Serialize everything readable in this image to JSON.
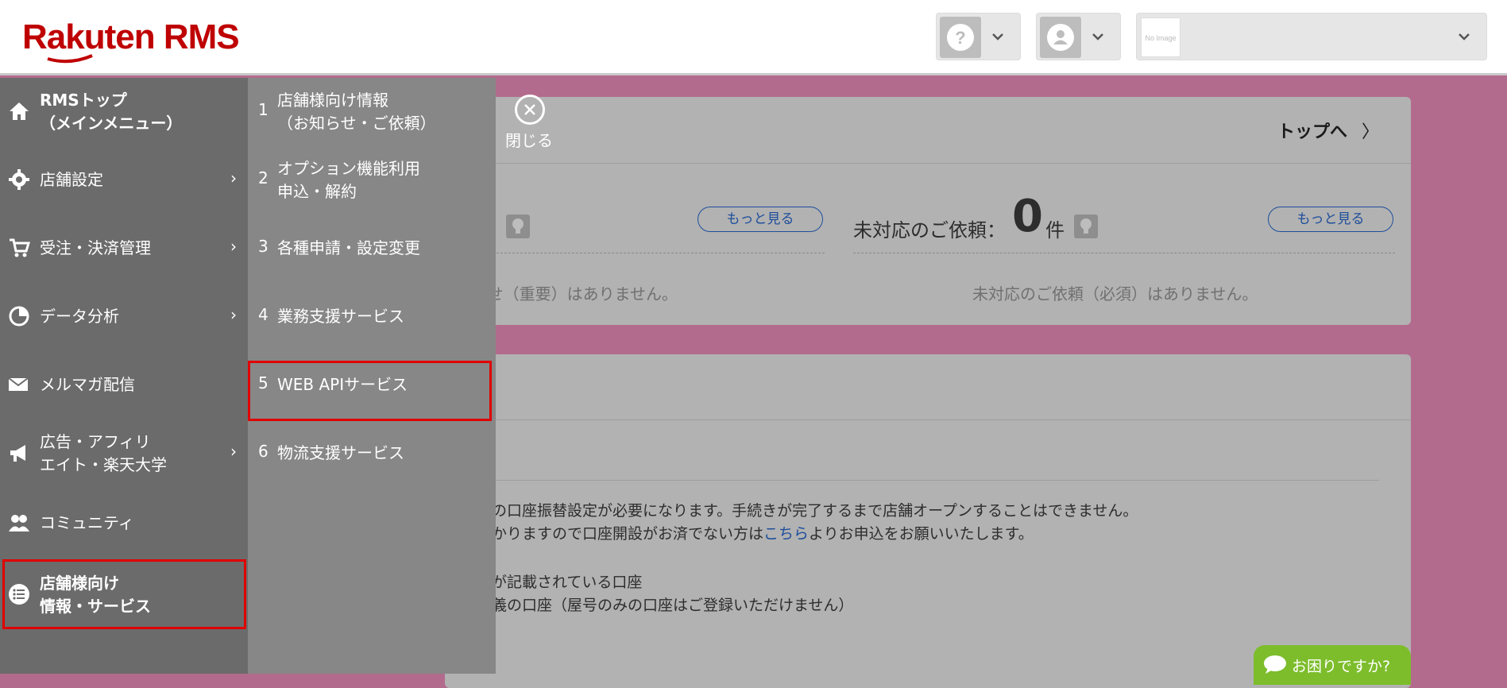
{
  "header": {
    "logo_text": "Rakuten RMS",
    "help_icon": "question-circle-icon",
    "user_icon": "user-icon",
    "shop_thumb_text": "No Image"
  },
  "background": {
    "top_link": "トップへ",
    "more_label": "もっと見る",
    "requests_label": "未対応のご依頼：",
    "requests_count": "0",
    "requests_unit": "件",
    "notice_none_partial": "らせ（重要）はありません。",
    "requests_none": "未対応のご依頼（必須）はありません。",
    "line1": "行の口座振替設定が必要になります。手続きが完了するまで店舗オープンすることはできません。",
    "line2_pre": "かかりますので口座開設がお済でない方は",
    "line2_link": "こちら",
    "line2_post": "よりお申込をお願いいたします。",
    "line3": "名が記載されている口座",
    "line4": "名義の口座（屋号のみの口座はご登録いただけません）",
    "help_label": "お困りですか?"
  },
  "menu": {
    "items": [
      {
        "line1": "RMSトップ",
        "line2": "（メインメニュー）",
        "icon": "home-icon"
      },
      {
        "line1": "店舗設定",
        "icon": "gear-icon"
      },
      {
        "line1": "受注・決済管理",
        "icon": "cart-icon"
      },
      {
        "line1": "データ分析",
        "icon": "pie-chart-icon"
      },
      {
        "line1": "メルマガ配信",
        "icon": "mail-icon"
      },
      {
        "line1": "広告・アフィリ",
        "line2": "エイト・楽天大学",
        "icon": "megaphone-icon"
      },
      {
        "line1": "コミュニティ",
        "icon": "people-icon"
      },
      {
        "line1": "店舗様向け",
        "line2": "情報・サービス",
        "icon": "list-icon"
      }
    ],
    "sub_items": [
      {
        "num": "1",
        "line1": "店舗様向け情報",
        "line2": "（お知らせ・ご依頼）"
      },
      {
        "num": "2",
        "line1": "オプション機能利用",
        "line2": "申込・解約"
      },
      {
        "num": "3",
        "line1": "各種申請・設定変更"
      },
      {
        "num": "4",
        "line1": "業務支援サービス"
      },
      {
        "num": "5",
        "line1": "WEB APIサービス"
      },
      {
        "num": "6",
        "line1": "物流支援サービス"
      }
    ],
    "close_label": "閉じる"
  },
  "colors": {
    "brand": "#bf0000",
    "page_bg": "#b36b8d",
    "menu_primary": "#6b6b6b",
    "menu_secondary": "#878787",
    "highlight": "#e00000",
    "link": "#1d4e9b",
    "help_green": "#7dbd2c"
  }
}
